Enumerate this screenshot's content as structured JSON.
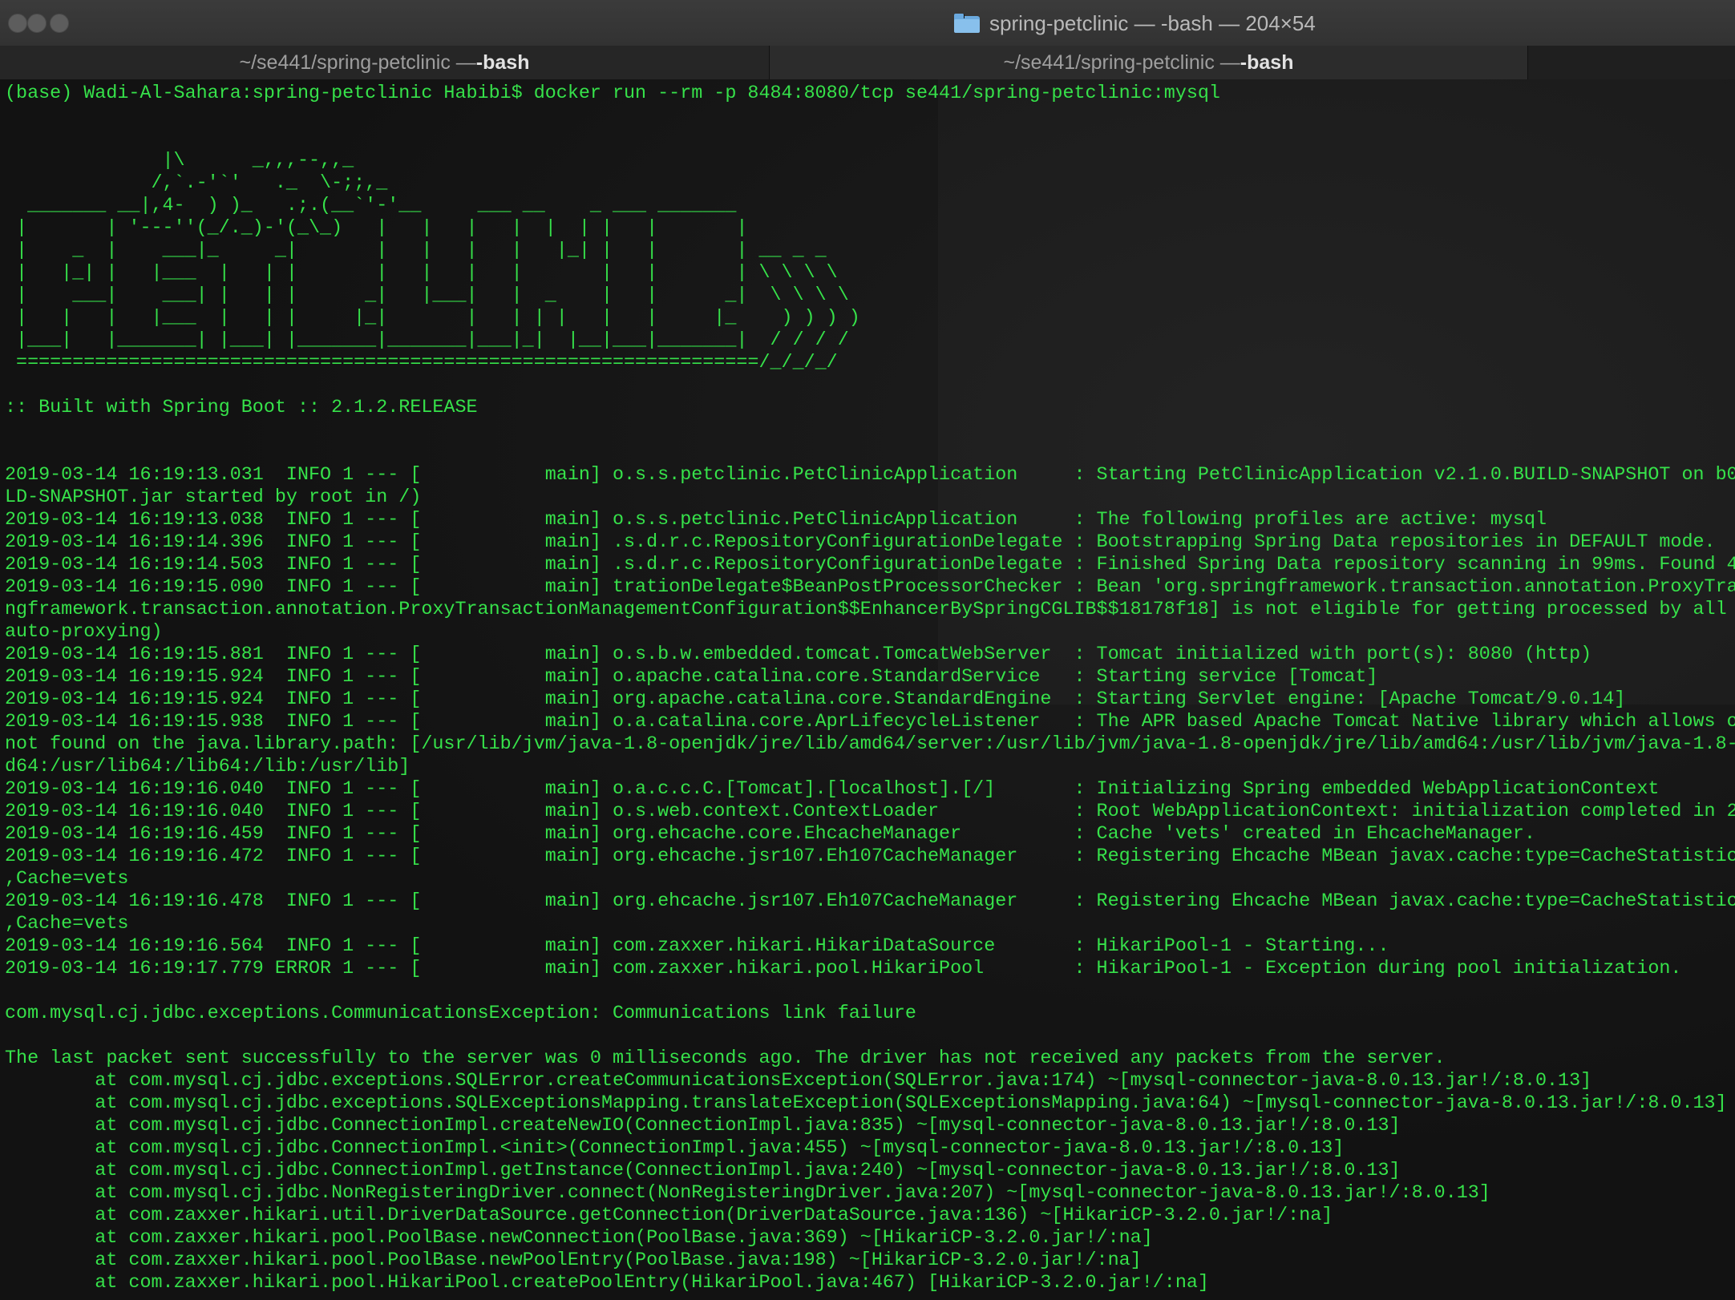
{
  "window": {
    "title": "spring-petclinic — -bash — 204×54"
  },
  "tabs": [
    {
      "path": "~/se441/spring-petclinic — ",
      "proc": "-bash"
    },
    {
      "path": "~/se441/spring-petclinic — ",
      "proc": "-bash"
    }
  ],
  "terminal": {
    "prompt_line": "(base) Wadi-Al-Sahara:spring-petclinic Habibi$ docker run --rm -p 8484:8080/tcp se441/spring-petclinic:mysql",
    "banner": "\n\n              |\\      _,,,--,,_\n             /,`.-'`'   ._  \\-;;,_\n  _______ __|,4-  ) )_   .;.(__`'-'__     ___ __    _ ___ _______\n |       | '---''(_/._)-'(_\\_)   |   |   |   |  |  | |   |       |\n |    _  |    ___|_     _|       |   |   |   |   |_| |   |       | __ _ _\n |   |_| |   |___  |   | |       |   |   |   |       |   |       | \\ \\ \\ \\\n |    ___|    ___| |   | |      _|   |___|   |  _    |   |      _|  \\ \\ \\ \\\n |   |   |   |___  |   | |     |_|       |   | | |   |   |     |_    ) ) ) )\n |___|   |_______| |___| |_______|_______|___|_|  |__|___|_______|  / / / /\n ==================================================================/_/_/_/\n\n:: Built with Spring Boot :: 2.1.2.RELEASE\n\n",
    "log": "2019-03-14 16:19:13.031  INFO 1 --- [           main] o.s.s.petclinic.PetClinicApplication     : Starting PetClinicApplication v2.1.0.BUILD-SNAPSHOT on b0\nLD-SNAPSHOT.jar started by root in /)\n2019-03-14 16:19:13.038  INFO 1 --- [           main] o.s.s.petclinic.PetClinicApplication     : The following profiles are active: mysql\n2019-03-14 16:19:14.396  INFO 1 --- [           main] .s.d.r.c.RepositoryConfigurationDelegate : Bootstrapping Spring Data repositories in DEFAULT mode.\n2019-03-14 16:19:14.503  INFO 1 --- [           main] .s.d.r.c.RepositoryConfigurationDelegate : Finished Spring Data repository scanning in 99ms. Found 4\n2019-03-14 16:19:15.090  INFO 1 --- [           main] trationDelegate$BeanPostProcessorChecker : Bean 'org.springframework.transaction.annotation.ProxyTra\nngframework.transaction.annotation.ProxyTransactionManagementConfiguration$$EnhancerBySpringCGLIB$$18178f18] is not eligible for getting processed by all\nauto-proxying)\n2019-03-14 16:19:15.881  INFO 1 --- [           main] o.s.b.w.embedded.tomcat.TomcatWebServer  : Tomcat initialized with port(s): 8080 (http)\n2019-03-14 16:19:15.924  INFO 1 --- [           main] o.apache.catalina.core.StandardService   : Starting service [Tomcat]\n2019-03-14 16:19:15.924  INFO 1 --- [           main] org.apache.catalina.core.StandardEngine  : Starting Servlet engine: [Apache Tomcat/9.0.14]\n2019-03-14 16:19:15.938  INFO 1 --- [           main] o.a.catalina.core.AprLifecycleListener   : The APR based Apache Tomcat Native library which allows o\nnot found on the java.library.path: [/usr/lib/jvm/java-1.8-openjdk/jre/lib/amd64/server:/usr/lib/jvm/java-1.8-openjdk/jre/lib/amd64:/usr/lib/jvm/java-1.8-\nd64:/usr/lib64:/lib64:/lib:/usr/lib]\n2019-03-14 16:19:16.040  INFO 1 --- [           main] o.a.c.c.C.[Tomcat].[localhost].[/]       : Initializing Spring embedded WebApplicationContext\n2019-03-14 16:19:16.040  INFO 1 --- [           main] o.s.web.context.ContextLoader            : Root WebApplicationContext: initialization completed in 2\n2019-03-14 16:19:16.459  INFO 1 --- [           main] org.ehcache.core.EhcacheManager          : Cache 'vets' created in EhcacheManager.\n2019-03-14 16:19:16.472  INFO 1 --- [           main] org.ehcache.jsr107.Eh107CacheManager     : Registering Ehcache MBean javax.cache:type=CacheStatistic\n,Cache=vets\n2019-03-14 16:19:16.478  INFO 1 --- [           main] org.ehcache.jsr107.Eh107CacheManager     : Registering Ehcache MBean javax.cache:type=CacheStatistic\n,Cache=vets\n2019-03-14 16:19:16.564  INFO 1 --- [           main] com.zaxxer.hikari.HikariDataSource       : HikariPool-1 - Starting...\n2019-03-14 16:19:17.779 ERROR 1 --- [           main] com.zaxxer.hikari.pool.HikariPool        : HikariPool-1 - Exception during pool initialization.\n\ncom.mysql.cj.jdbc.exceptions.CommunicationsException: Communications link failure\n\nThe last packet sent successfully to the server was 0 milliseconds ago. The driver has not received any packets from the server.\n        at com.mysql.cj.jdbc.exceptions.SQLError.createCommunicationsException(SQLError.java:174) ~[mysql-connector-java-8.0.13.jar!/:8.0.13]\n        at com.mysql.cj.jdbc.exceptions.SQLExceptionsMapping.translateException(SQLExceptionsMapping.java:64) ~[mysql-connector-java-8.0.13.jar!/:8.0.13]\n        at com.mysql.cj.jdbc.ConnectionImpl.createNewIO(ConnectionImpl.java:835) ~[mysql-connector-java-8.0.13.jar!/:8.0.13]\n        at com.mysql.cj.jdbc.ConnectionImpl.<init>(ConnectionImpl.java:455) ~[mysql-connector-java-8.0.13.jar!/:8.0.13]\n        at com.mysql.cj.jdbc.ConnectionImpl.getInstance(ConnectionImpl.java:240) ~[mysql-connector-java-8.0.13.jar!/:8.0.13]\n        at com.mysql.cj.jdbc.NonRegisteringDriver.connect(NonRegisteringDriver.java:207) ~[mysql-connector-java-8.0.13.jar!/:8.0.13]\n        at com.zaxxer.hikari.util.DriverDataSource.getConnection(DriverDataSource.java:136) ~[HikariCP-3.2.0.jar!/:na]\n        at com.zaxxer.hikari.pool.PoolBase.newConnection(PoolBase.java:369) ~[HikariCP-3.2.0.jar!/:na]\n        at com.zaxxer.hikari.pool.PoolBase.newPoolEntry(PoolBase.java:198) ~[HikariCP-3.2.0.jar!/:na]\n        at com.zaxxer.hikari.pool.HikariPool.createPoolEntry(HikariPool.java:467) [HikariCP-3.2.0.jar!/:na]"
  },
  "colors": {
    "terminal_text": "#36e24a",
    "terminal_bg": "#121212",
    "titlebar_bg": "#353535",
    "traffic_light": "#5d5d5d",
    "folder_icon": "#6aa9de"
  },
  "icons": {
    "close": "traffic-light-close",
    "minimize": "traffic-light-minimize",
    "zoom": "traffic-light-zoom",
    "title": "folder-icon"
  }
}
